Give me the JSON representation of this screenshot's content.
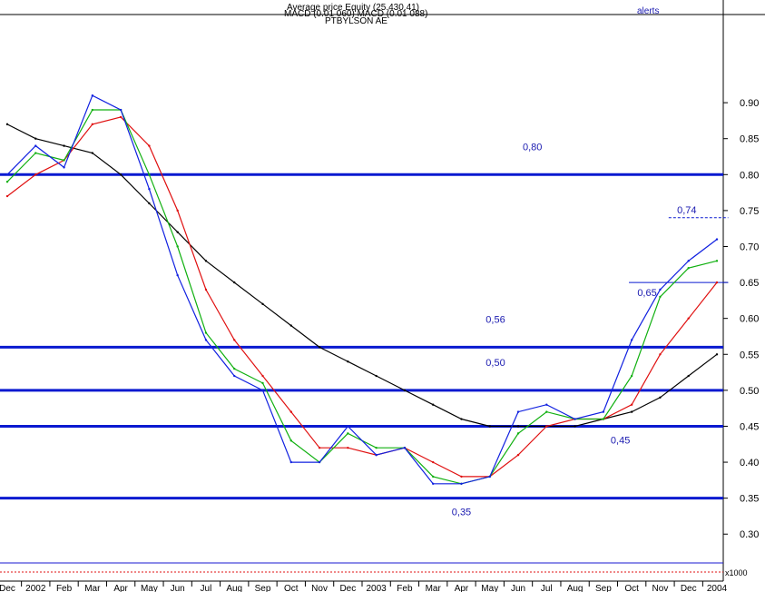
{
  "header": {
    "line1": "Average price Equity (25.430.41)",
    "line2": "MACD (0.01 060) MACD (0.01 088)",
    "line3": "PTBYLSON AE",
    "alerts": "alerts"
  },
  "chart_data": {
    "type": "line",
    "title": "",
    "ylim": [
      0.27,
      1.01
    ],
    "grid": false,
    "y_ticks": [
      "0.30",
      "0.35",
      "0.40",
      "0.45",
      "0.50",
      "0.55",
      "0.60",
      "0.65",
      "0.70",
      "0.75",
      "0.80",
      "0.85",
      "0.90"
    ],
    "x_ticks": [
      "Dec",
      "2002",
      "Feb",
      "Mar",
      "Apr",
      "May",
      "Jun",
      "Jul",
      "Aug",
      "Sep",
      "Oct",
      "Nov",
      "Dec",
      "2003",
      "Feb",
      "Mar",
      "Apr",
      "May",
      "Jun",
      "Jul",
      "Aug",
      "Sep",
      "Oct",
      "Nov",
      "Dec",
      "2004"
    ],
    "volume_unit": "x1000",
    "series": [
      {
        "color": "#000000",
        "x": [
          0,
          1,
          2,
          3,
          4,
          5,
          6,
          7,
          8,
          9,
          10,
          11,
          12,
          13,
          14,
          15,
          16,
          17,
          18,
          19,
          20,
          21,
          22,
          23,
          24,
          25
        ],
        "values": [
          0.87,
          0.85,
          0.84,
          0.83,
          0.8,
          0.76,
          0.72,
          0.68,
          0.65,
          0.62,
          0.59,
          0.56,
          0.54,
          0.52,
          0.5,
          0.48,
          0.46,
          0.45,
          0.45,
          0.45,
          0.45,
          0.46,
          0.47,
          0.49,
          0.52,
          0.55
        ]
      },
      {
        "color": "#e01010",
        "x": [
          0,
          1,
          2,
          3,
          4,
          5,
          6,
          7,
          8,
          9,
          10,
          11,
          12,
          13,
          14,
          15,
          16,
          17,
          18,
          19,
          20,
          21,
          22,
          23,
          24,
          25
        ],
        "values": [
          0.77,
          0.8,
          0.82,
          0.87,
          0.88,
          0.84,
          0.75,
          0.64,
          0.57,
          0.52,
          0.47,
          0.42,
          0.42,
          0.41,
          0.42,
          0.4,
          0.38,
          0.38,
          0.41,
          0.45,
          0.46,
          0.46,
          0.48,
          0.55,
          0.6,
          0.65
        ]
      },
      {
        "color": "#10b010",
        "x": [
          0,
          1,
          2,
          3,
          4,
          5,
          6,
          7,
          8,
          9,
          10,
          11,
          12,
          13,
          14,
          15,
          16,
          17,
          18,
          19,
          20,
          21,
          22,
          23,
          24,
          25
        ],
        "values": [
          0.79,
          0.83,
          0.82,
          0.89,
          0.89,
          0.8,
          0.7,
          0.58,
          0.53,
          0.51,
          0.43,
          0.4,
          0.44,
          0.42,
          0.42,
          0.38,
          0.37,
          0.38,
          0.44,
          0.47,
          0.46,
          0.46,
          0.52,
          0.63,
          0.67,
          0.68
        ]
      },
      {
        "color": "#1020e0",
        "x": [
          0,
          1,
          2,
          3,
          4,
          5,
          6,
          7,
          8,
          9,
          10,
          11,
          12,
          13,
          14,
          15,
          16,
          17,
          18,
          19,
          20,
          21,
          22,
          23,
          24,
          25
        ],
        "values": [
          0.8,
          0.84,
          0.81,
          0.91,
          0.89,
          0.78,
          0.66,
          0.57,
          0.52,
          0.5,
          0.4,
          0.4,
          0.45,
          0.41,
          0.42,
          0.37,
          0.37,
          0.38,
          0.47,
          0.48,
          0.46,
          0.47,
          0.57,
          0.64,
          0.68,
          0.71
        ]
      }
    ],
    "horizontal_lines": [
      {
        "value": 0.8,
        "label": "0,80",
        "label_at": 18.5
      },
      {
        "value": 0.56,
        "label": "0,56",
        "label_at": 17.2
      },
      {
        "value": 0.5,
        "label": "0,50",
        "label_at": 17.2
      },
      {
        "value": 0.45,
        "label": "0,45",
        "label_at": 21.6
      },
      {
        "value": 0.35,
        "label": "0,35",
        "label_at": 16.0
      }
    ],
    "resistance_lines": [
      {
        "value": 0.74,
        "from": 23.3,
        "to": 25.4,
        "label": "0,74"
      },
      {
        "value": 0.65,
        "from": 21.9,
        "to": 25.4,
        "label": "0,65"
      }
    ]
  },
  "colors": {
    "support_line": "#0a1ad0",
    "axis": "#000000",
    "label": "#1a1ab0"
  }
}
